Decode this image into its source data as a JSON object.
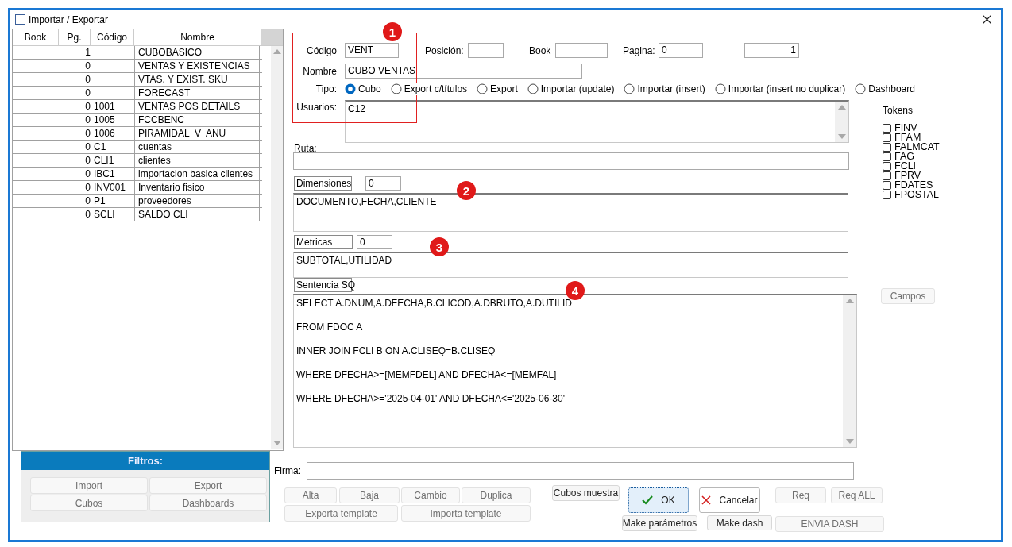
{
  "window": {
    "title": "Importar / Exportar"
  },
  "list": {
    "columns": [
      "Book",
      "Pg.",
      "Código",
      "Nombre"
    ],
    "rows": [
      {
        "pg": "1",
        "nombre": "CUBOBASICO"
      },
      {
        "pg": "0",
        "nombre": "VENTAS Y EXISTENCIAS"
      },
      {
        "pg": "0",
        "nombre": "VTAS. Y EXIST. SKU"
      },
      {
        "pg": "0",
        "nombre": "FORECAST"
      },
      {
        "pg": "0",
        "codigo": "1001",
        "nombre": "VENTAS POS DETAILS"
      },
      {
        "pg": "0",
        "codigo": "1005",
        "nombre": "FCCBENC"
      },
      {
        "pg": "0",
        "codigo": "1006",
        "nombre": "PIRAMIDAL  V  ANU"
      },
      {
        "pg": "0",
        "codigo": "C1",
        "nombre": "cuentas"
      },
      {
        "pg": "0",
        "codigo": "CLI1",
        "nombre": "clientes"
      },
      {
        "pg": "0",
        "codigo": "IBC1",
        "nombre": "importacion basica clientes"
      },
      {
        "pg": "0",
        "codigo": "INV001",
        "nombre": "Inventario fisico"
      },
      {
        "pg": "0",
        "codigo": "P1",
        "nombre": "proveedores"
      },
      {
        "pg": "0",
        "codigo": "SCLI",
        "nombre": "SALDO CLI"
      }
    ]
  },
  "form": {
    "codigo_label": "Código",
    "codigo": "VENT",
    "posicion_label": "Posición:",
    "book_label": "Book",
    "pagina_label": "Pagina:",
    "pagina": "0",
    "field_5": "1",
    "nombre_label": "Nombre",
    "nombre": "CUBO VENTAS",
    "tipo_label": "Tipo:",
    "tipo_options": [
      {
        "label": "Cubo",
        "selected": true
      },
      {
        "label": "Export c/títulos",
        "selected": false
      },
      {
        "label": "Export",
        "selected": false
      },
      {
        "label": "Importar (update)",
        "selected": false
      },
      {
        "label": "Importar (insert)",
        "selected": false
      },
      {
        "label": "Importar (insert no duplicar)",
        "selected": false
      },
      {
        "label": "Dashboard",
        "selected": false
      }
    ],
    "usuarios_label": "Usuarios:",
    "usuarios": "C12",
    "ruta_label": "Ruta:",
    "dimensiones_label": "Dimensiones",
    "dimensiones_count": "0",
    "dimensiones": "DOCUMENTO,FECHA,CLIENTE",
    "metricas_label": "Metricas",
    "metricas_count": "0",
    "metricas": "SUBTOTAL,UTILIDAD",
    "sql_label": "Sentencia SQ",
    "sql_lines": [
      "SELECT A.DNUM,A.DFECHA,B.CLICOD,A.DBRUTO,A.DUTILID",
      "FROM FDOC A",
      "INNER JOIN FCLI B ON A.CLISEQ=B.CLISEQ",
      "WHERE DFECHA>=[MEMFDEL] AND DFECHA<=[MEMFAL]",
      "WHERE DFECHA>='2025-04-01' AND DFECHA<='2025-06-30'"
    ]
  },
  "tokens": {
    "title": "Tokens",
    "items": [
      {
        "label": "FINV",
        "checked": false
      },
      {
        "label": "FFAM",
        "checked": false
      },
      {
        "label": "FALMCAT",
        "checked": false
      },
      {
        "label": "FAG",
        "checked": false
      },
      {
        "label": "FCLI",
        "checked": false
      },
      {
        "label": "FPRV",
        "checked": false
      },
      {
        "label": "FDATES",
        "checked": false
      },
      {
        "label": "FPOSTAL",
        "checked": false
      }
    ]
  },
  "campos_button": {
    "label": "Campos",
    "disabled": true
  },
  "filtros": {
    "title": "Filtros:",
    "buttons": [
      {
        "label": "Import",
        "disabled": true
      },
      {
        "label": "Export",
        "disabled": true
      },
      {
        "label": "Cubos",
        "disabled": true
      },
      {
        "label": "Dashboards",
        "disabled": true
      }
    ]
  },
  "firma_label": "Firma:",
  "actions": {
    "buttons": [
      {
        "label": "Alta",
        "kind": "plain",
        "disabled": true
      },
      {
        "label": "Baja",
        "kind": "plain",
        "disabled": true
      },
      {
        "label": "Cambio",
        "kind": "plain",
        "disabled": true
      },
      {
        "label": "Duplica",
        "kind": "plain",
        "disabled": true
      },
      {
        "label": "Exporta template",
        "kind": "plain",
        "disabled": true
      },
      {
        "label": "Importa template",
        "kind": "plain",
        "disabled": true
      },
      {
        "label": "Cubos muestra",
        "kind": "plain",
        "disabled": false
      },
      {
        "label": "OK",
        "kind": "default",
        "disabled": false
      },
      {
        "label": "Make parámetros",
        "kind": "plain",
        "disabled": false
      },
      {
        "label": "Cancelar",
        "kind": "cancel",
        "disabled": false
      },
      {
        "label": "Make dash",
        "kind": "plain",
        "disabled": false
      },
      {
        "label": "Req",
        "kind": "plain",
        "disabled": true
      },
      {
        "label": "Req ALL",
        "kind": "plain",
        "disabled": true
      },
      {
        "label": "ENVIA DASH",
        "kind": "plain",
        "disabled": true
      }
    ]
  },
  "annotations": {
    "markers": [
      "1",
      "2",
      "3",
      "4"
    ]
  }
}
